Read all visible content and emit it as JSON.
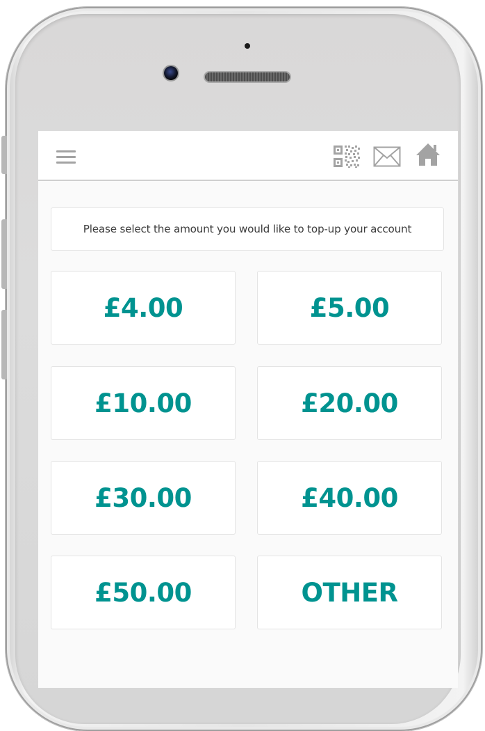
{
  "header": {
    "menu_icon": "hamburger-menu-icon",
    "icons": [
      "qr-code-icon",
      "mail-icon",
      "home-icon"
    ],
    "icon_color": "#a3a3a3"
  },
  "topup": {
    "prompt": "Please select the amount you would like to top-up your account",
    "accent_color": "#009390",
    "amounts": [
      "£4.00",
      "£5.00",
      "£10.00",
      "£20.00",
      "£30.00",
      "£40.00",
      "£50.00",
      "OTHER"
    ]
  }
}
